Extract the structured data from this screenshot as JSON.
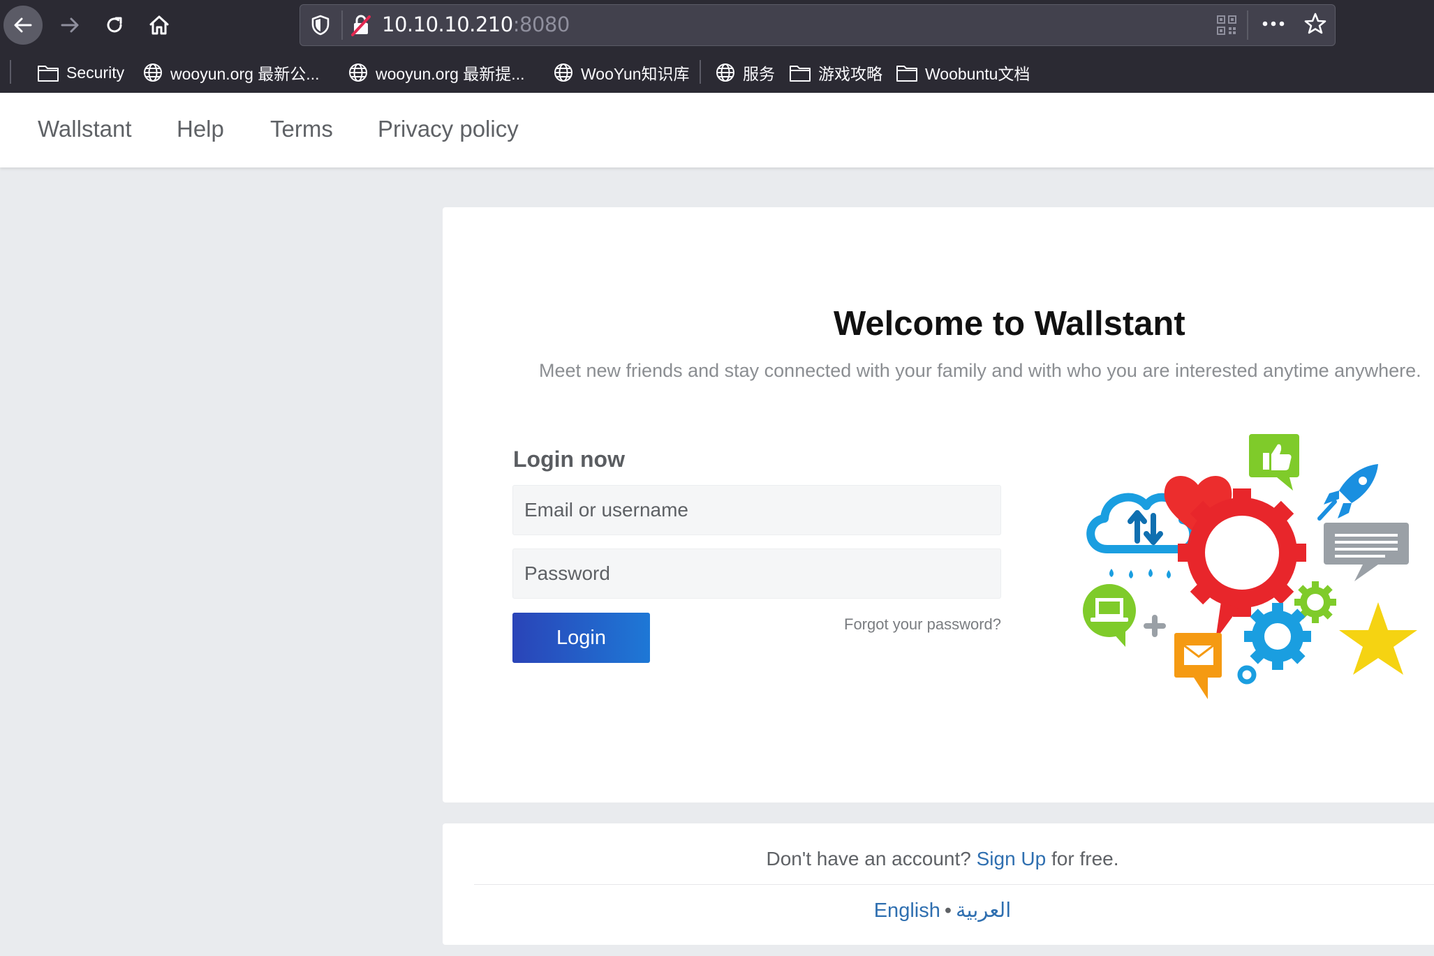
{
  "browser": {
    "url_host": "10.10.10.210",
    "url_port": ":8080",
    "bookmarks": [
      {
        "label": "Security",
        "icon": "folder-icon"
      },
      {
        "label": "wooyun.org 最新公...",
        "icon": "globe-icon"
      },
      {
        "label": "wooyun.org 最新提...",
        "icon": "globe-icon"
      },
      {
        "label": "WooYun知识库",
        "icon": "globe-icon"
      },
      {
        "label": "服务",
        "icon": "globe-icon"
      },
      {
        "label": "游戏攻略",
        "icon": "folder-icon"
      },
      {
        "label": "Woobuntu文档",
        "icon": "folder-icon"
      }
    ]
  },
  "nav": {
    "links": [
      "Wallstant",
      "Help",
      "Terms",
      "Privacy policy"
    ]
  },
  "card": {
    "title": "Welcome to Wallstant",
    "subtitle": "Meet new friends and stay connected with your family and with who you are interested anytime anywhere.",
    "login_heading": "Login now",
    "email_placeholder": "Email or username",
    "password_placeholder": "Password",
    "login_button": "Login",
    "forgot_link": "Forgot your password?"
  },
  "footer": {
    "signup_prefix": "Don't have an account?",
    "signup_link": "Sign Up",
    "signup_suffix": "for free.",
    "lang_english": "English",
    "lang_dot": "•",
    "lang_arabic": "العربية"
  },
  "colors": {
    "browser_chrome": "#2b2a33",
    "page_background": "#e9ebee",
    "login_button_start": "#2a44b8",
    "login_button_end": "#1e78d6",
    "link": "#2f6fb0"
  }
}
